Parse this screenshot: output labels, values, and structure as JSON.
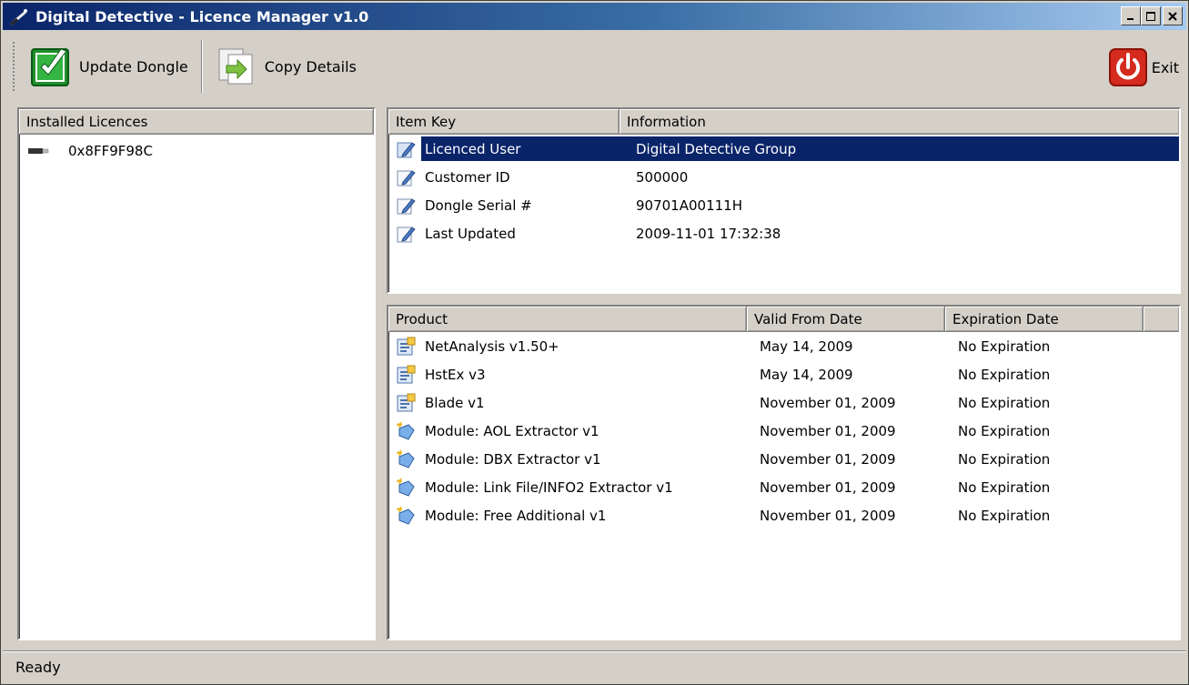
{
  "window": {
    "title": "Digital Detective - Licence Manager v1.0"
  },
  "toolbar": {
    "update_label": "Update Dongle",
    "copy_label": "Copy Details",
    "exit_label": "Exit"
  },
  "installed": {
    "header": "Installed Licences",
    "items": [
      {
        "label": "0x8FF9F98C"
      }
    ]
  },
  "info_table": {
    "columns": [
      "Item Key",
      "Information"
    ],
    "rows": [
      {
        "key": "Licenced User",
        "value": "Digital Detective Group",
        "selected": true
      },
      {
        "key": "Customer ID",
        "value": "500000"
      },
      {
        "key": "Dongle Serial #",
        "value": "90701A00111H"
      },
      {
        "key": "Last Updated",
        "value": "2009-11-01 17:32:38"
      }
    ]
  },
  "product_table": {
    "columns": [
      "Product",
      "Valid From Date",
      "Expiration Date"
    ],
    "rows": [
      {
        "product": "NetAnalysis v1.50+",
        "valid_from": "May 14, 2009",
        "expiration": "No Expiration",
        "icon": "document-icon"
      },
      {
        "product": "HstEx v3",
        "valid_from": "May 14, 2009",
        "expiration": "No Expiration",
        "icon": "document-icon"
      },
      {
        "product": "Blade v1",
        "valid_from": "November 01, 2009",
        "expiration": "No Expiration",
        "icon": "document-icon"
      },
      {
        "product": "Module: AOL Extractor v1",
        "valid_from": "November 01, 2009",
        "expiration": "No Expiration",
        "icon": "module-icon"
      },
      {
        "product": "Module: DBX Extractor v1",
        "valid_from": "November 01, 2009",
        "expiration": "No Expiration",
        "icon": "module-icon"
      },
      {
        "product": "Module: Link File/INFO2 Extractor v1",
        "valid_from": "November 01, 2009",
        "expiration": "No Expiration",
        "icon": "module-icon"
      },
      {
        "product": "Module: Free Additional v1",
        "valid_from": "November 01, 2009",
        "expiration": "No Expiration",
        "icon": "module-icon"
      }
    ]
  },
  "status": {
    "text": "Ready"
  },
  "colors": {
    "selection": "#0a246a",
    "window_bg": "#d4d0c8",
    "update_icon": "#2ea53a",
    "exit_icon": "#d52a1e"
  }
}
